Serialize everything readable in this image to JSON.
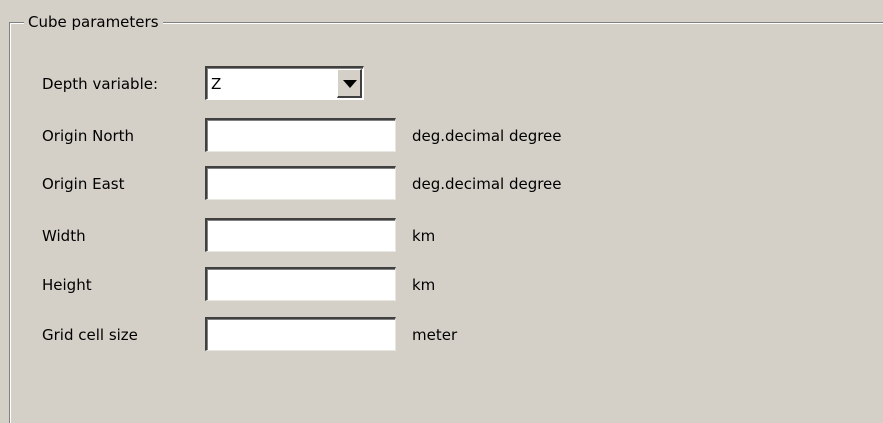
{
  "group": {
    "title": "Cube parameters"
  },
  "depth": {
    "label": "Depth variable:",
    "selected": "Z"
  },
  "rows": [
    {
      "label": "Origin North",
      "value": "",
      "unit": "deg.decimal degree"
    },
    {
      "label": "Origin East",
      "value": "",
      "unit": "deg.decimal degree"
    },
    {
      "label": "Width",
      "value": "",
      "unit": "km"
    },
    {
      "label": "Height",
      "value": "",
      "unit": "km"
    },
    {
      "label": "Grid cell size",
      "value": "",
      "unit": "meter"
    }
  ]
}
